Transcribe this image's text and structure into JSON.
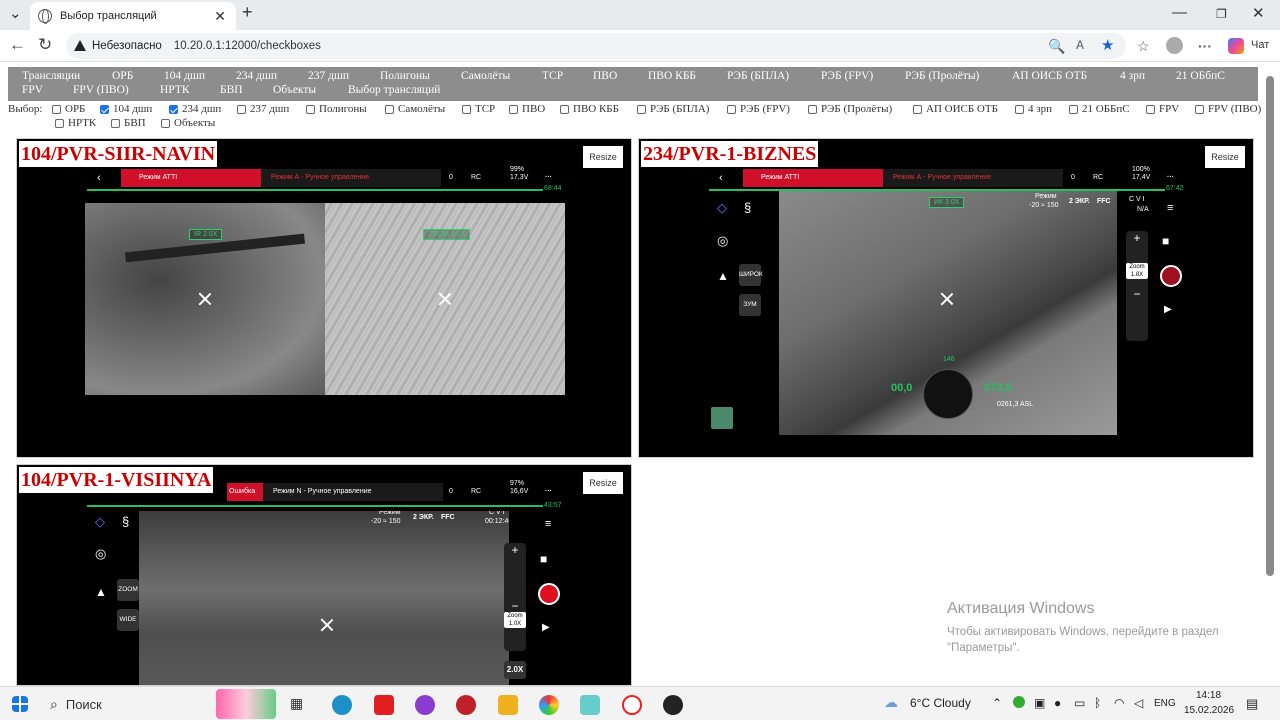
{
  "browser": {
    "tab_title": "Выбор трансляций",
    "security_label": "Небезопасно",
    "url": "10.20.0.1:12000/checkboxes",
    "profile_label": "Чат"
  },
  "menu": [
    "Трансляции",
    "ОРБ",
    "104 дшп",
    "234 дшп",
    "237 дшп",
    "Полигоны",
    "Самолёты",
    "ТСР",
    "ПВО",
    "ПВО КББ",
    "РЭБ (БПЛА)",
    "РЭБ (FPV)",
    "РЭБ (Пролёты)",
    "АП ОИСБ ОТБ",
    "4 зрп",
    "21 ОБбпС",
    "FPV",
    "FPV (ПВО)",
    "НРТК",
    "БВП",
    "Объекты",
    "Выбор трансляций"
  ],
  "selection": {
    "label": "Выбор:",
    "items": [
      {
        "label": "ОРБ",
        "checked": false
      },
      {
        "label": "104 дшп",
        "checked": true
      },
      {
        "label": "234 дшп",
        "checked": true
      },
      {
        "label": "237 дшп",
        "checked": false
      },
      {
        "label": "Полигоны",
        "checked": false
      },
      {
        "label": "Самолёты",
        "checked": false
      },
      {
        "label": "ТСР",
        "checked": false
      },
      {
        "label": "ПВО",
        "checked": false
      },
      {
        "label": "ПВО КББ",
        "checked": false
      },
      {
        "label": "РЭБ (БПЛА)",
        "checked": false
      },
      {
        "label": "РЭБ (FPV)",
        "checked": false
      },
      {
        "label": "РЭБ (Пролёты)",
        "checked": false
      },
      {
        "label": "АП ОИСБ ОТБ",
        "checked": false
      },
      {
        "label": "4 зрп",
        "checked": false
      },
      {
        "label": "21 ОББпС",
        "checked": false
      },
      {
        "label": "FPV",
        "checked": false
      },
      {
        "label": "FPV (ПВО)",
        "checked": false
      },
      {
        "label": "НРТК",
        "checked": false
      },
      {
        "label": "БВП",
        "checked": false
      },
      {
        "label": "Объекты",
        "checked": false
      }
    ]
  },
  "streams": [
    {
      "title": "104/PVR-SIIR-NAVIN",
      "resize": "Resize",
      "mode": "Режим ATTI",
      "control": "Режим А - Ручное управление",
      "battery": "99%",
      "voltage": "17,3V",
      "timer": "68:44",
      "lens1": "IR 2.0X",
      "lens2": "ZOOM 2.0X",
      "signal": "RC",
      "zero": "0"
    },
    {
      "title": "234/PVR-1-BIZNES",
      "resize": "Resize",
      "mode": "Режим ATTI",
      "control": "Режим А - Ручное управление",
      "battery": "100%",
      "voltage": "17,4V",
      "timer": "67:42",
      "lens1": "ИК 3.0X",
      "range_label": "Режим",
      "range": "-20 ≈ 150",
      "ekr": "2 ЭКР.",
      "ffc": "FFC",
      "cvi": "C V I",
      "na": "N/A",
      "btn1": "ШИРОК",
      "btn2": "ЗУМ",
      "zoom_label": "Zoom",
      "zoom_val": "1.8X",
      "tel_left": "00,0",
      "tel_right": "073,5",
      "tel_top": "146",
      "alt": "0261,3 ASL",
      "signal": "RC",
      "zero": "0"
    },
    {
      "title": "104/PVR-1-VISIINYA",
      "resize": "Resize",
      "mode": "Ошибка",
      "control": "Режим N - Ручное управление",
      "battery": "97%",
      "voltage": "16,6V",
      "timer": "43:57",
      "range_label": "Режим",
      "range": "-20 ≈ 150",
      "ekr": "2 ЭКР.",
      "ffc": "FFC",
      "cvi": "C V I",
      "clock": "00:12:46",
      "btn1": "ZOOM",
      "btn2": "WIDE",
      "zoom_label": "Zoom",
      "zoom_val": "1.0X",
      "zoom_bottom": "2.0X",
      "signal": "RC",
      "zero": "0"
    }
  ],
  "watermark": {
    "title": "Активация Windows",
    "text": "Чтобы активировать Windows, перейдите в раздел \"Параметры\"."
  },
  "taskbar": {
    "search": "Поиск",
    "weather": "6°C  Cloudy",
    "lang": "ENG",
    "time": "14:18",
    "date": "15.02.2026"
  },
  "colors": {
    "menu_bg": "#8d8d8d",
    "title_red": "#cc0000",
    "mode_red": "#d0102a",
    "hud_green": "#25c060"
  }
}
